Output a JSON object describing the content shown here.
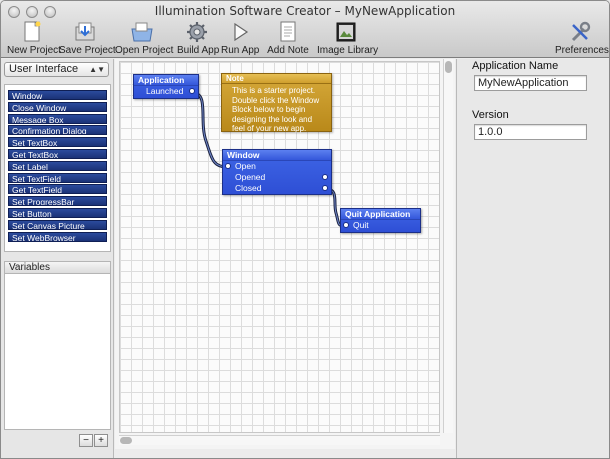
{
  "window": {
    "title": "Illumination Software Creator – MyNewApplication"
  },
  "toolbar": {
    "items": [
      {
        "label": "New Project",
        "icon": "new-project-icon"
      },
      {
        "label": "Save Project",
        "icon": "save-project-icon"
      },
      {
        "label": "Open Project",
        "icon": "open-project-icon"
      },
      {
        "label": "Build App",
        "icon": "build-app-icon"
      },
      {
        "label": "Run App",
        "icon": "run-app-icon"
      },
      {
        "label": "Add Note",
        "icon": "add-note-icon"
      },
      {
        "label": "Image Library",
        "icon": "image-library-icon"
      },
      {
        "label": "Preferences",
        "icon": "preferences-icon"
      }
    ]
  },
  "sidebar": {
    "category": "User Interface",
    "commands": [
      "Window",
      "Close Window",
      "Message Box",
      "Confirmation Dialog",
      "Set TextBox",
      "Get TextBox",
      "Set Label",
      "Set TextField",
      "Get TextField",
      "Set ProgressBar",
      "Set Button",
      "Set Canvas Picture",
      "Set WebBrowser"
    ],
    "variables_header": "Variables",
    "add_label": "+",
    "remove_label": "−"
  },
  "canvas": {
    "application_block": {
      "title": "Application",
      "rows": [
        "Launched"
      ]
    },
    "note_block": {
      "title": "Note",
      "lines": [
        "This is a starter project.",
        "Double click the Window",
        "Block below to begin",
        "designing the look and",
        "feel of your new app."
      ]
    },
    "window_block": {
      "title": "Window",
      "rows": [
        "Open",
        "Opened",
        "Closed"
      ]
    },
    "quit_block": {
      "title": "Quit Application",
      "rows": [
        "Quit"
      ]
    }
  },
  "inspector": {
    "app_name_label": "Application Name",
    "app_name_value": "MyNewApplication",
    "version_label": "Version",
    "version_value": "1.0.0"
  },
  "colors": {
    "block_blue": "#2e4fd5",
    "note_gold": "#c4951f",
    "command_navy": "#1f3a85"
  }
}
